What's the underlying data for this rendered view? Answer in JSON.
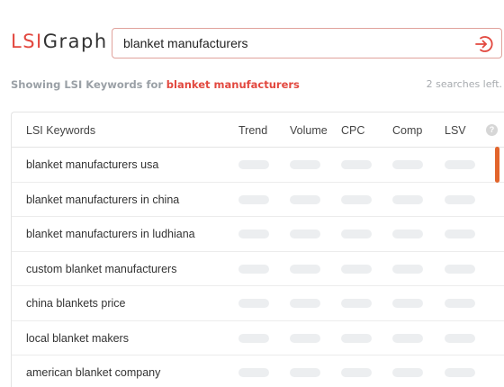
{
  "header": {
    "logo_lsi": "LSI",
    "logo_graph": "Graph",
    "search_value": "blanket manufacturers",
    "search_icon": "sign-in-arrow-icon"
  },
  "info": {
    "prefix": "Showing LSI Keywords for",
    "term": "blanket manufacturers",
    "remaining": "2 searches left."
  },
  "table": {
    "columns": {
      "keywords": "LSI Keywords",
      "trend": "Trend",
      "volume": "Volume",
      "cpc": "CPC",
      "comp": "Comp",
      "lsv": "LSV"
    },
    "help_icon": "question-circle-icon",
    "rows": [
      "blanket manufacturers usa",
      "blanket manufacturers in china",
      "blanket manufacturers in ludhiana",
      "custom blanket manufacturers",
      "china blankets price",
      "local blanket makers",
      "american blanket company"
    ]
  },
  "colors": {
    "brand": "#e2483f",
    "scrollbar": "#e2652c",
    "placeholder_pill": "#eceef0"
  }
}
